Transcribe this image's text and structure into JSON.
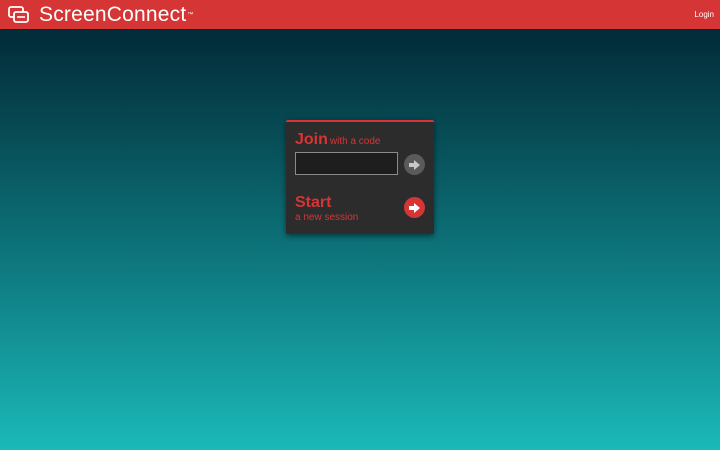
{
  "brand": {
    "name": "ScreenConnect",
    "tm": "™"
  },
  "header": {
    "login_label": "Login"
  },
  "join": {
    "title": "Join",
    "subtitle": "with a code",
    "code_value": "",
    "placeholder": ""
  },
  "start": {
    "title": "Start",
    "subtitle": "a new session"
  },
  "icons": {
    "logo": "screenconnect-logo-icon",
    "go": "arrow-right-icon"
  },
  "colors": {
    "brand_red": "#d63535",
    "panel_bg": "#2c2c2c",
    "bg_top": "#002230",
    "bg_bottom": "#1bb9b9",
    "join_button": "#5a5a5a"
  }
}
